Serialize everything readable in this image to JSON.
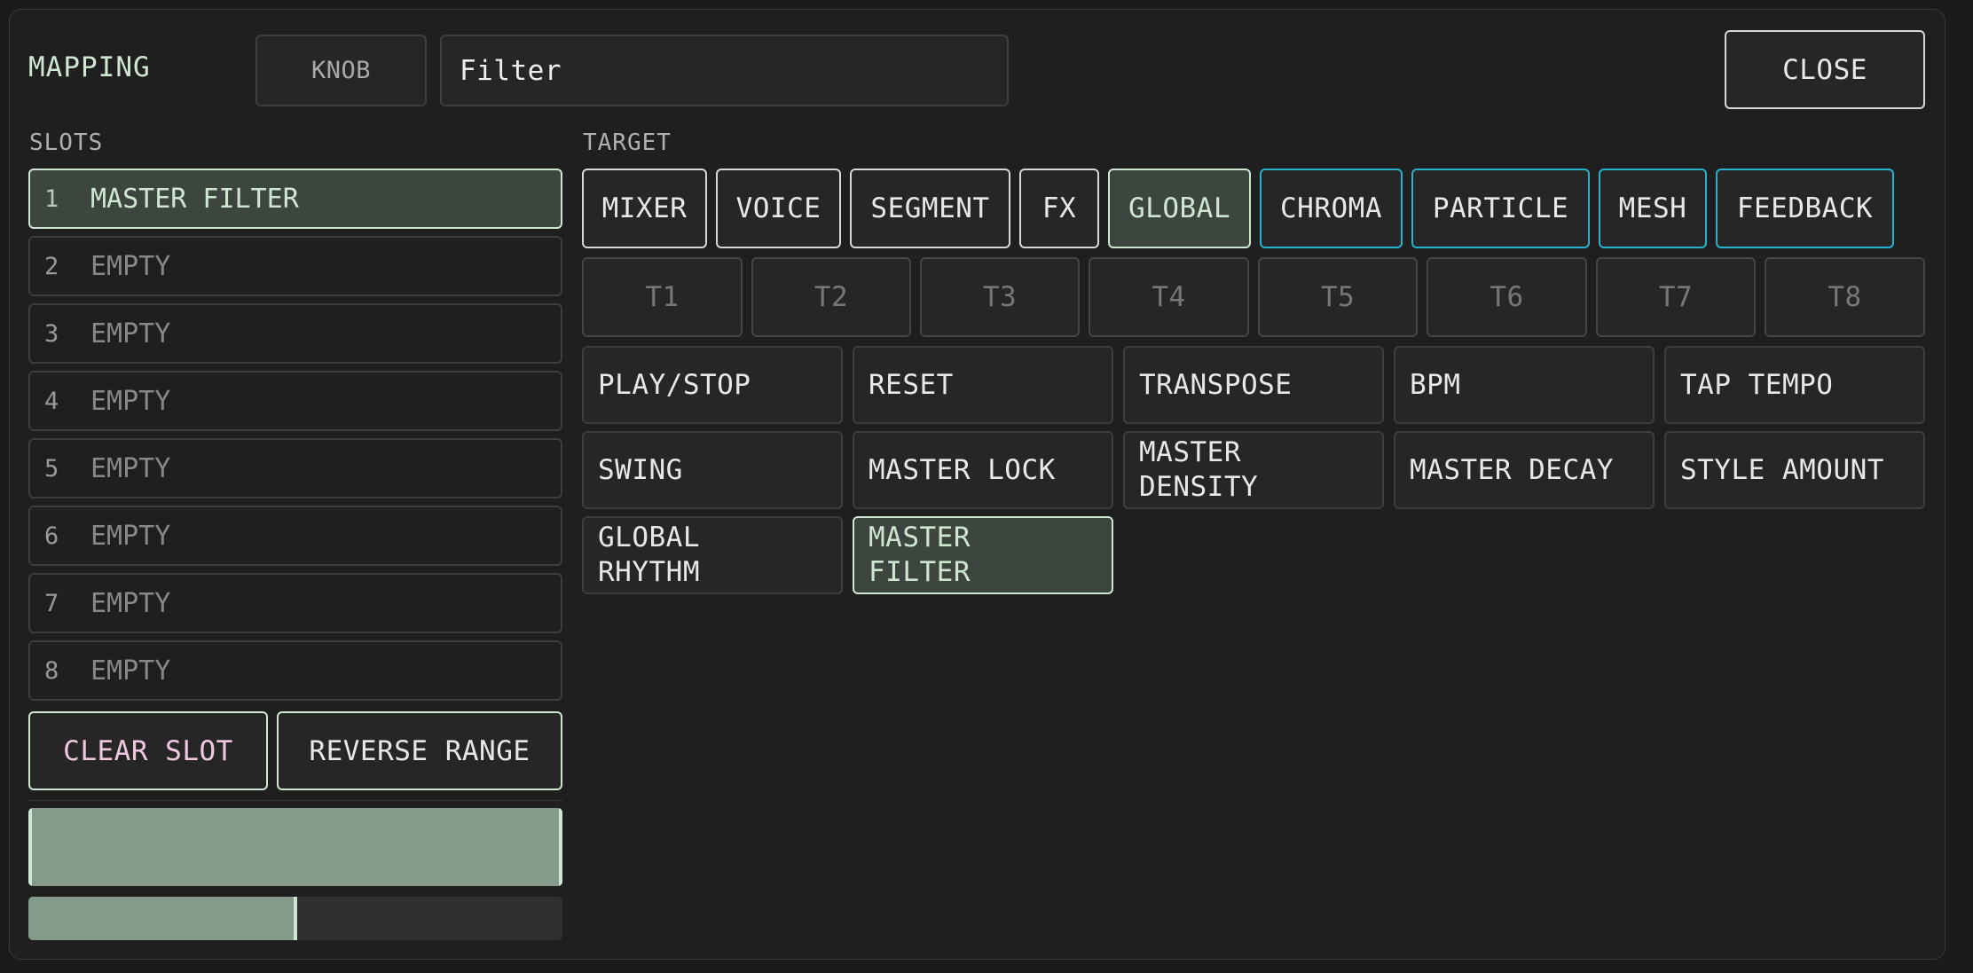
{
  "header": {
    "title": "MAPPING",
    "mode_button": "KNOB",
    "name_value": "Filter",
    "close_label": "CLOSE"
  },
  "slots": {
    "heading": "SLOTS",
    "items": [
      {
        "num": "1",
        "label": "MASTER FILTER"
      },
      {
        "num": "2",
        "label": "EMPTY"
      },
      {
        "num": "3",
        "label": "EMPTY"
      },
      {
        "num": "4",
        "label": "EMPTY"
      },
      {
        "num": "5",
        "label": "EMPTY"
      },
      {
        "num": "6",
        "label": "EMPTY"
      },
      {
        "num": "7",
        "label": "EMPTY"
      },
      {
        "num": "8",
        "label": "EMPTY"
      }
    ],
    "clear_label": "CLEAR SLOT",
    "reverse_label": "REVERSE RANGE",
    "range_min": 0.0,
    "range_max": 1.0,
    "value_fraction": 0.5
  },
  "target": {
    "heading": "TARGET",
    "categories": [
      "MIXER",
      "VOICE",
      "SEGMENT",
      "FX",
      "GLOBAL",
      "CHROMA",
      "PARTICLE",
      "MESH",
      "FEEDBACK"
    ],
    "active_category": "GLOBAL",
    "tracks": [
      "T1",
      "T2",
      "T3",
      "T4",
      "T5",
      "T6",
      "T7",
      "T8"
    ],
    "params": [
      "PLAY/STOP",
      "RESET",
      "TRANSPOSE",
      "BPM",
      "TAP TEMPO",
      "SWING",
      "MASTER LOCK",
      "MASTER DENSITY",
      "MASTER DECAY",
      "STYLE AMOUNT",
      "GLOBAL RHYTHM",
      "MASTER FILTER"
    ],
    "active_param": "MASTER FILTER"
  },
  "colors": {
    "accent_green": "#cfe7d2",
    "accent_cyan": "#27b3cf",
    "clear_text": "#f0c8e0",
    "bar_fill": "#849a8a"
  }
}
